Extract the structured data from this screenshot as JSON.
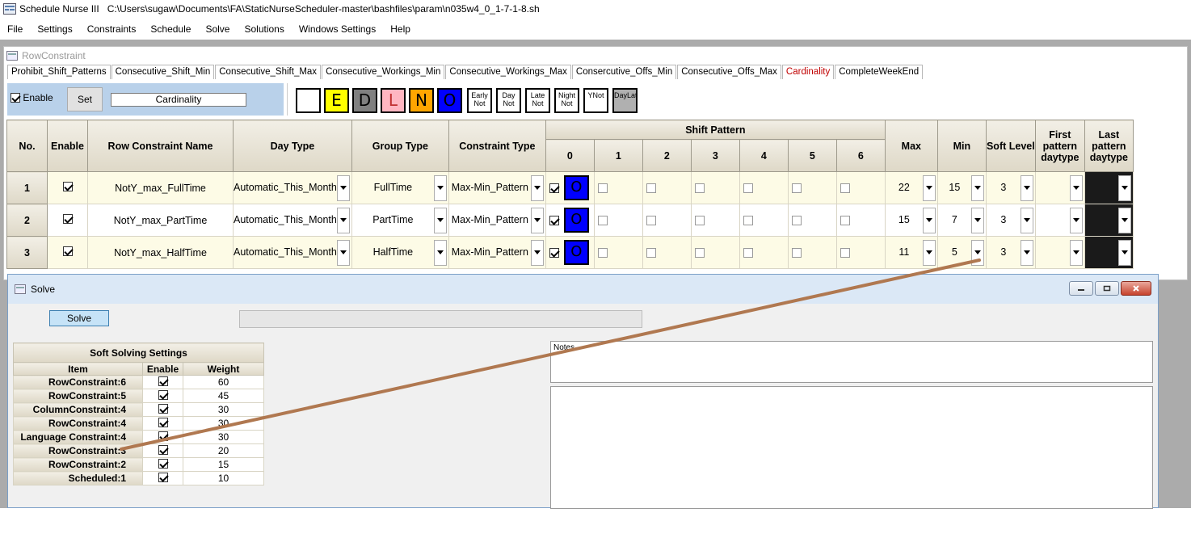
{
  "window": {
    "app_title": "Schedule Nurse III",
    "path": "C:\\Users\\sugaw\\Documents\\FA\\StaticNurseScheduler-master\\bashfiles\\param\\n035w4_0_1-7-1-8.sh"
  },
  "menu": [
    "File",
    "Settings",
    "Constraints",
    "Schedule",
    "Solve",
    "Solutions",
    "Windows Settings",
    "Help"
  ],
  "row_constraint_window": {
    "title": "RowConstraint",
    "tabs": [
      "Prohibit_Shift_Patterns",
      "Consecutive_Shift_Min",
      "Consecutive_Shift_Max",
      "Consecutive_Workings_Min",
      "Consecutive_Workings_Max",
      "Consercutive_Offs_Min",
      "Consecutive_Offs_Max",
      "Cardinality",
      "CompleteWeekEnd"
    ],
    "active_tab": "Cardinality",
    "enable_label": "Enable",
    "set_label": "Set",
    "name_value": "Cardinality",
    "palette": [
      {
        "label": "",
        "color": "#ffffff"
      },
      {
        "label": "E",
        "color": "#ffff00"
      },
      {
        "label": "D",
        "color": "#808080"
      },
      {
        "label": "L",
        "color": "#ffb6c1"
      },
      {
        "label": "N",
        "color": "#ffa500"
      },
      {
        "label": "O",
        "color": "#0000ff"
      },
      {
        "label": "Early Not",
        "color": "#ffffff"
      },
      {
        "label": "Day Not",
        "color": "#ffffff"
      },
      {
        "label": "Late Not",
        "color": "#ffffff"
      },
      {
        "label": "Night Not",
        "color": "#ffffff"
      },
      {
        "label": "YNot",
        "color": "#ffffff"
      },
      {
        "label": "DayLateNot",
        "color": "#b0b0b0"
      }
    ],
    "headers": {
      "no": "No.",
      "enable": "Enable",
      "name": "Row Constraint Name",
      "day_type": "Day Type",
      "group_type": "Group Type",
      "constraint_type": "Constraint Type",
      "shift_pattern": "Shift Pattern",
      "shift_cols": [
        "0",
        "1",
        "2",
        "3",
        "4",
        "5",
        "6"
      ],
      "max": "Max",
      "min": "Min",
      "soft_level": "Soft Level",
      "first": "First pattern daytype",
      "last": "Last pattern daytype"
    },
    "rows": [
      {
        "no": "1",
        "name": "NotY_max_FullTime",
        "day_type": "Automatic_This_Month",
        "group_type": "FullTime",
        "constraint_type": "Max-Min_Pattern",
        "shift0": "O",
        "max": "22",
        "min": "15",
        "soft_level": "3"
      },
      {
        "no": "2",
        "name": "NotY_max_PartTime",
        "day_type": "Automatic_This_Month",
        "group_type": "PartTime",
        "constraint_type": "Max-Min_Pattern",
        "shift0": "O",
        "max": "15",
        "min": "7",
        "soft_level": "3"
      },
      {
        "no": "3",
        "name": "NotY_max_HalfTime",
        "day_type": "Automatic_This_Month",
        "group_type": "HalfTime",
        "constraint_type": "Max-Min_Pattern",
        "shift0": "O",
        "max": "11",
        "min": "5",
        "soft_level": "3"
      }
    ]
  },
  "solve_window": {
    "title": "Solve",
    "solve_label": "Solve",
    "soft_settings": {
      "title": "Soft Solving Settings",
      "headers": [
        "Item",
        "Enable",
        "Weight"
      ],
      "rows": [
        {
          "item": "RowConstraint:6",
          "weight": "60"
        },
        {
          "item": "RowConstraint:5",
          "weight": "45"
        },
        {
          "item": "ColumnConstraint:4",
          "weight": "30"
        },
        {
          "item": "RowConstraint:4",
          "weight": "30"
        },
        {
          "item": "Language Constraint:4",
          "weight": "30"
        },
        {
          "item": "RowConstraint:3",
          "weight": "20"
        },
        {
          "item": "RowConstraint:2",
          "weight": "15"
        },
        {
          "item": "Scheduled:1",
          "weight": "10"
        }
      ]
    },
    "notes_text": "Notes"
  },
  "colors": {
    "annotation_line": "#b07850",
    "row_band": "#fdfbe6",
    "active_tab": "#c00000"
  }
}
